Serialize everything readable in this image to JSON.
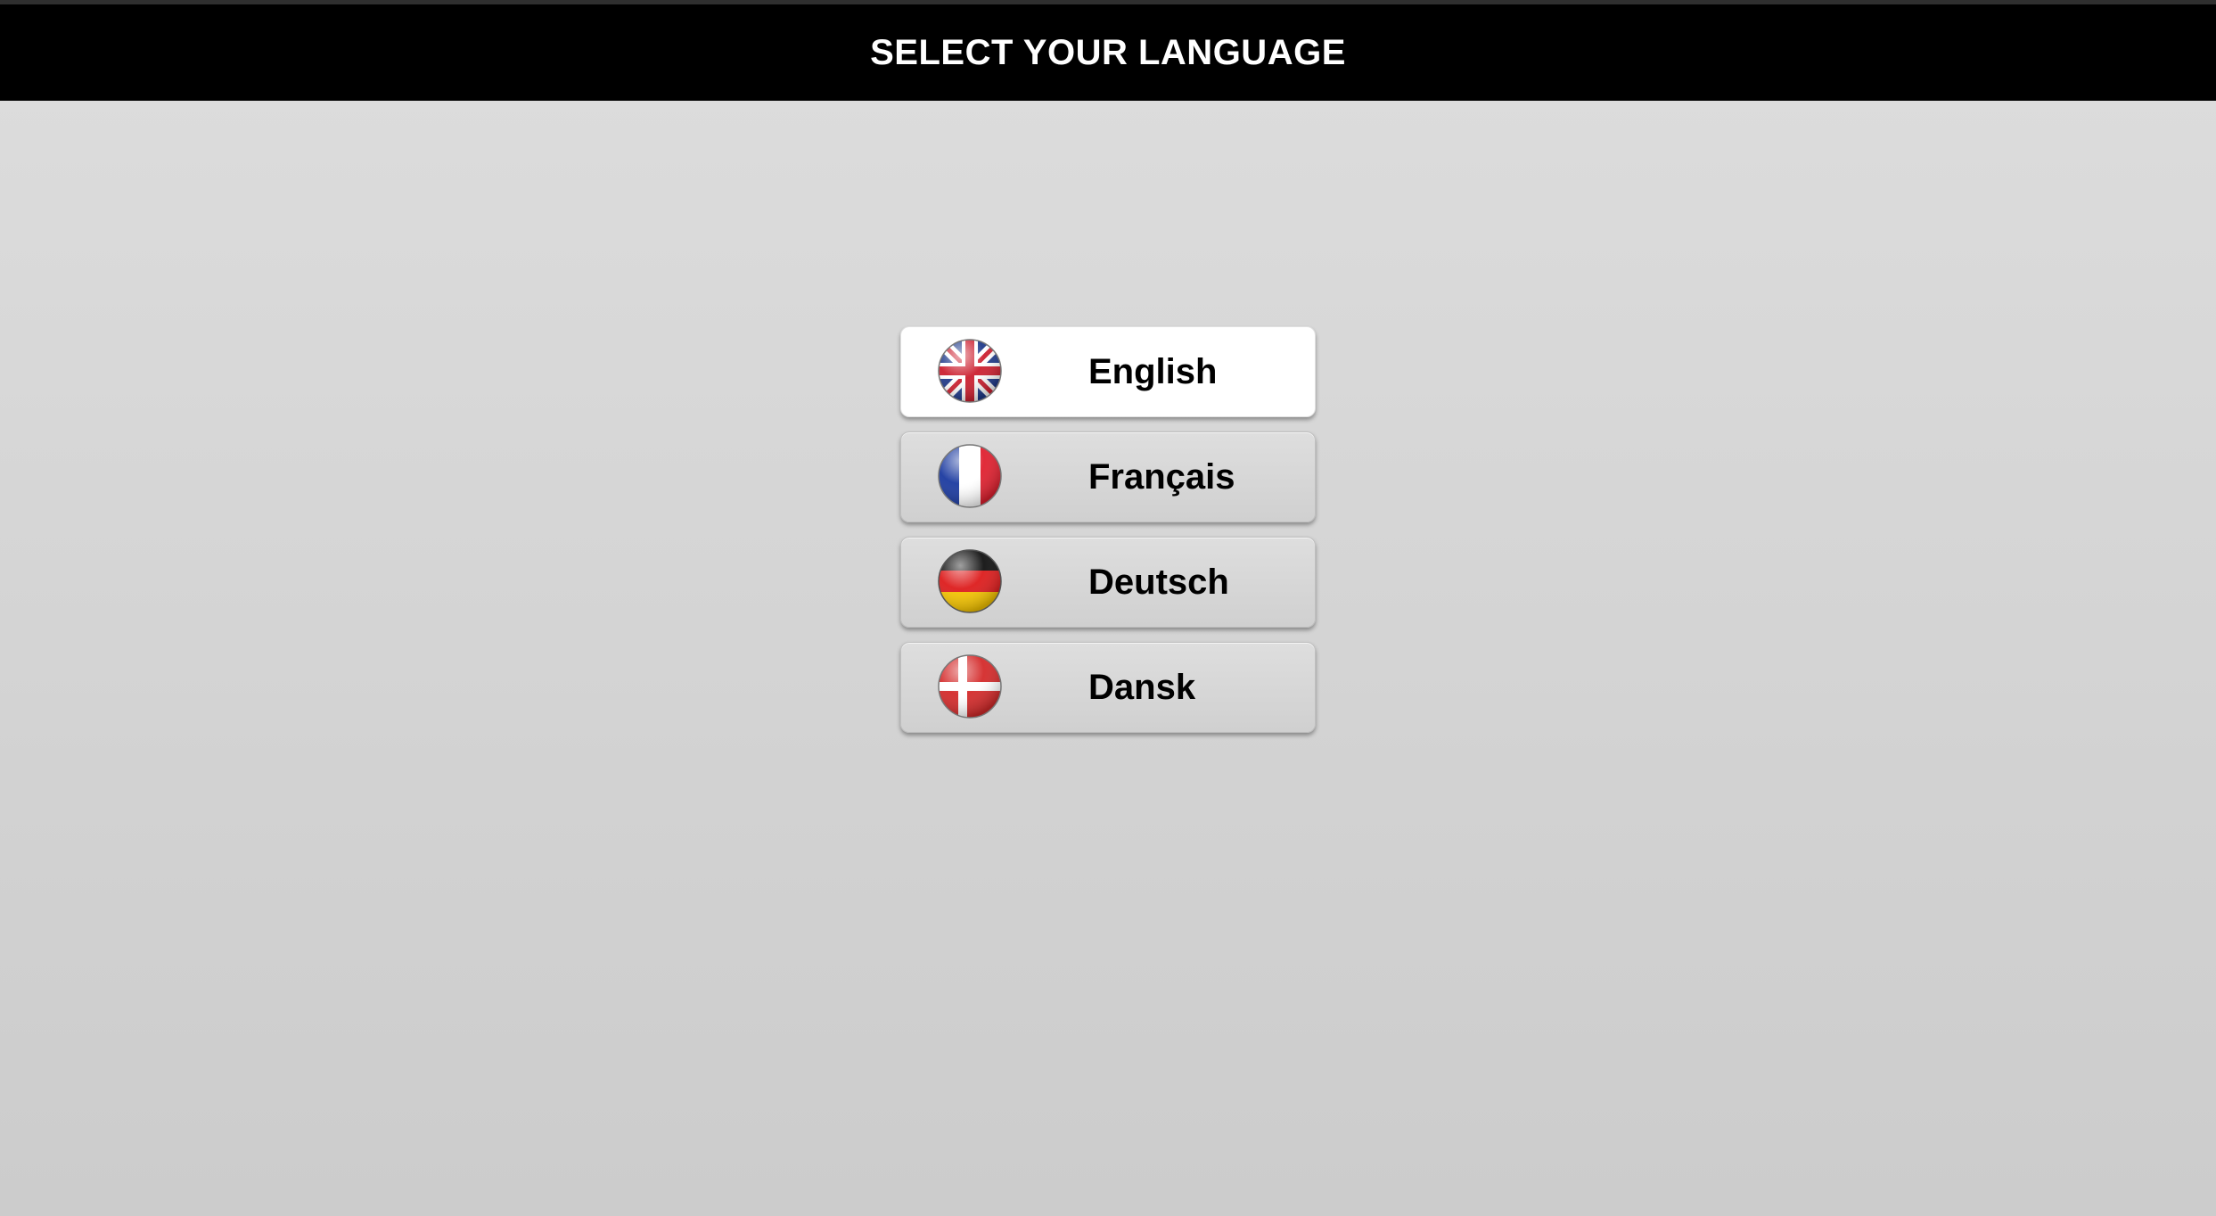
{
  "header": {
    "title": "SELECT YOUR LANGUAGE"
  },
  "languages": [
    {
      "label": "English",
      "flag": "uk-flag-icon",
      "selected": true
    },
    {
      "label": "Français",
      "flag": "france-flag-icon",
      "selected": false
    },
    {
      "label": "Deutsch",
      "flag": "germany-flag-icon",
      "selected": false
    },
    {
      "label": "Dansk",
      "flag": "denmark-flag-icon",
      "selected": false
    }
  ],
  "colors": {
    "header_bg": "#000000",
    "header_text": "#ffffff",
    "selected_bg": "#ffffff",
    "button_bg": "#d6d6d6"
  }
}
